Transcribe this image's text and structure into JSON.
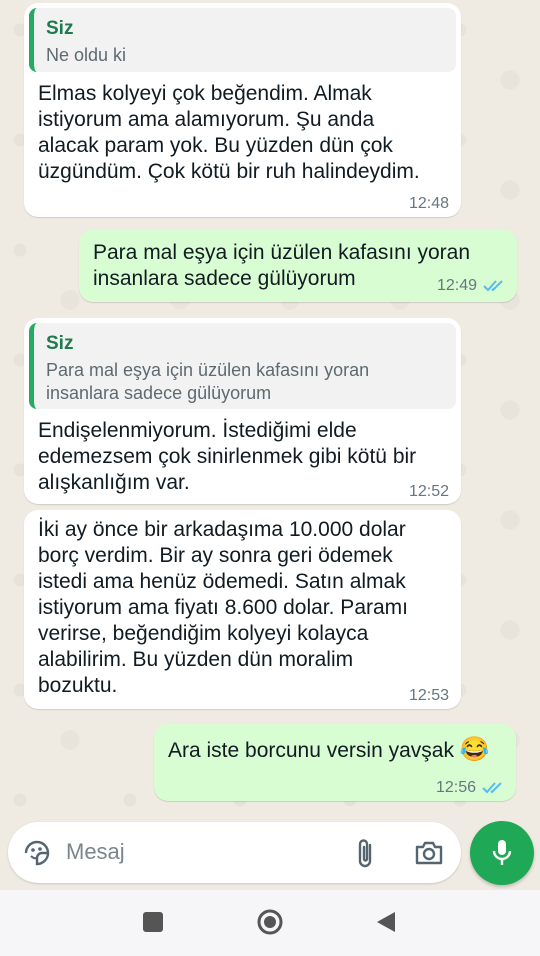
{
  "messages": [
    {
      "direction": "in",
      "quote_author": "Siz",
      "quote_text": "Ne oldu ki",
      "lines": [
        "Elmas kolyeyi çok beğendim. Almak",
        "istiyorum ama alamıyorum. Şu anda",
        "alacak param yok. Bu yüzden dün çok",
        "üzgündüm. Çok kötü bir ruh halindeydim."
      ],
      "time": "12:48"
    },
    {
      "direction": "out",
      "lines": [
        "Para mal eşya için üzülen kafasını yoran",
        "insanlara sadece gülüyorum"
      ],
      "time": "12:49",
      "status": "read"
    },
    {
      "direction": "in",
      "quote_author": "Siz",
      "quote_lines": [
        "Para mal eşya için üzülen kafasını yoran",
        "insanlara sadece gülüyorum"
      ],
      "lines": [
        "Endişelenmiyorum. İstediğimi elde",
        "edemezsem çok sinirlenmek gibi kötü bir",
        "alışkanlığım var."
      ],
      "time": "12:52"
    },
    {
      "direction": "in",
      "lines": [
        "İki ay önce bir arkadaşıma 10.000 dolar",
        "borç verdim. Bir ay sonra geri ödemek",
        "istedi ama henüz ödemedi. Satın almak",
        "istiyorum ama fiyatı 8.600 dolar. Paramı",
        "verirse, beğendiğim kolyeyi kolayca",
        "alabilirim. Bu yüzden dün moralim",
        "bozuktu."
      ],
      "time": "12:53"
    },
    {
      "direction": "out",
      "text": "Ara iste borcunu versin yavşak",
      "emoji": "😂",
      "time": "12:56",
      "status": "read"
    }
  ],
  "composer": {
    "placeholder": "Mesaj",
    "icons": [
      "sticker-icon",
      "attach-icon",
      "camera-icon",
      "mic-icon"
    ]
  },
  "navbar": {
    "icons": [
      "recents-square-icon",
      "home-circle-icon",
      "back-triangle-icon"
    ]
  },
  "colors": {
    "chat_bg": "#efeae2",
    "incoming_bubble": "#ffffff",
    "outgoing_bubble": "#d9fdd3",
    "accent_green": "#1fa855",
    "read_ticks": "#53bdeb"
  }
}
